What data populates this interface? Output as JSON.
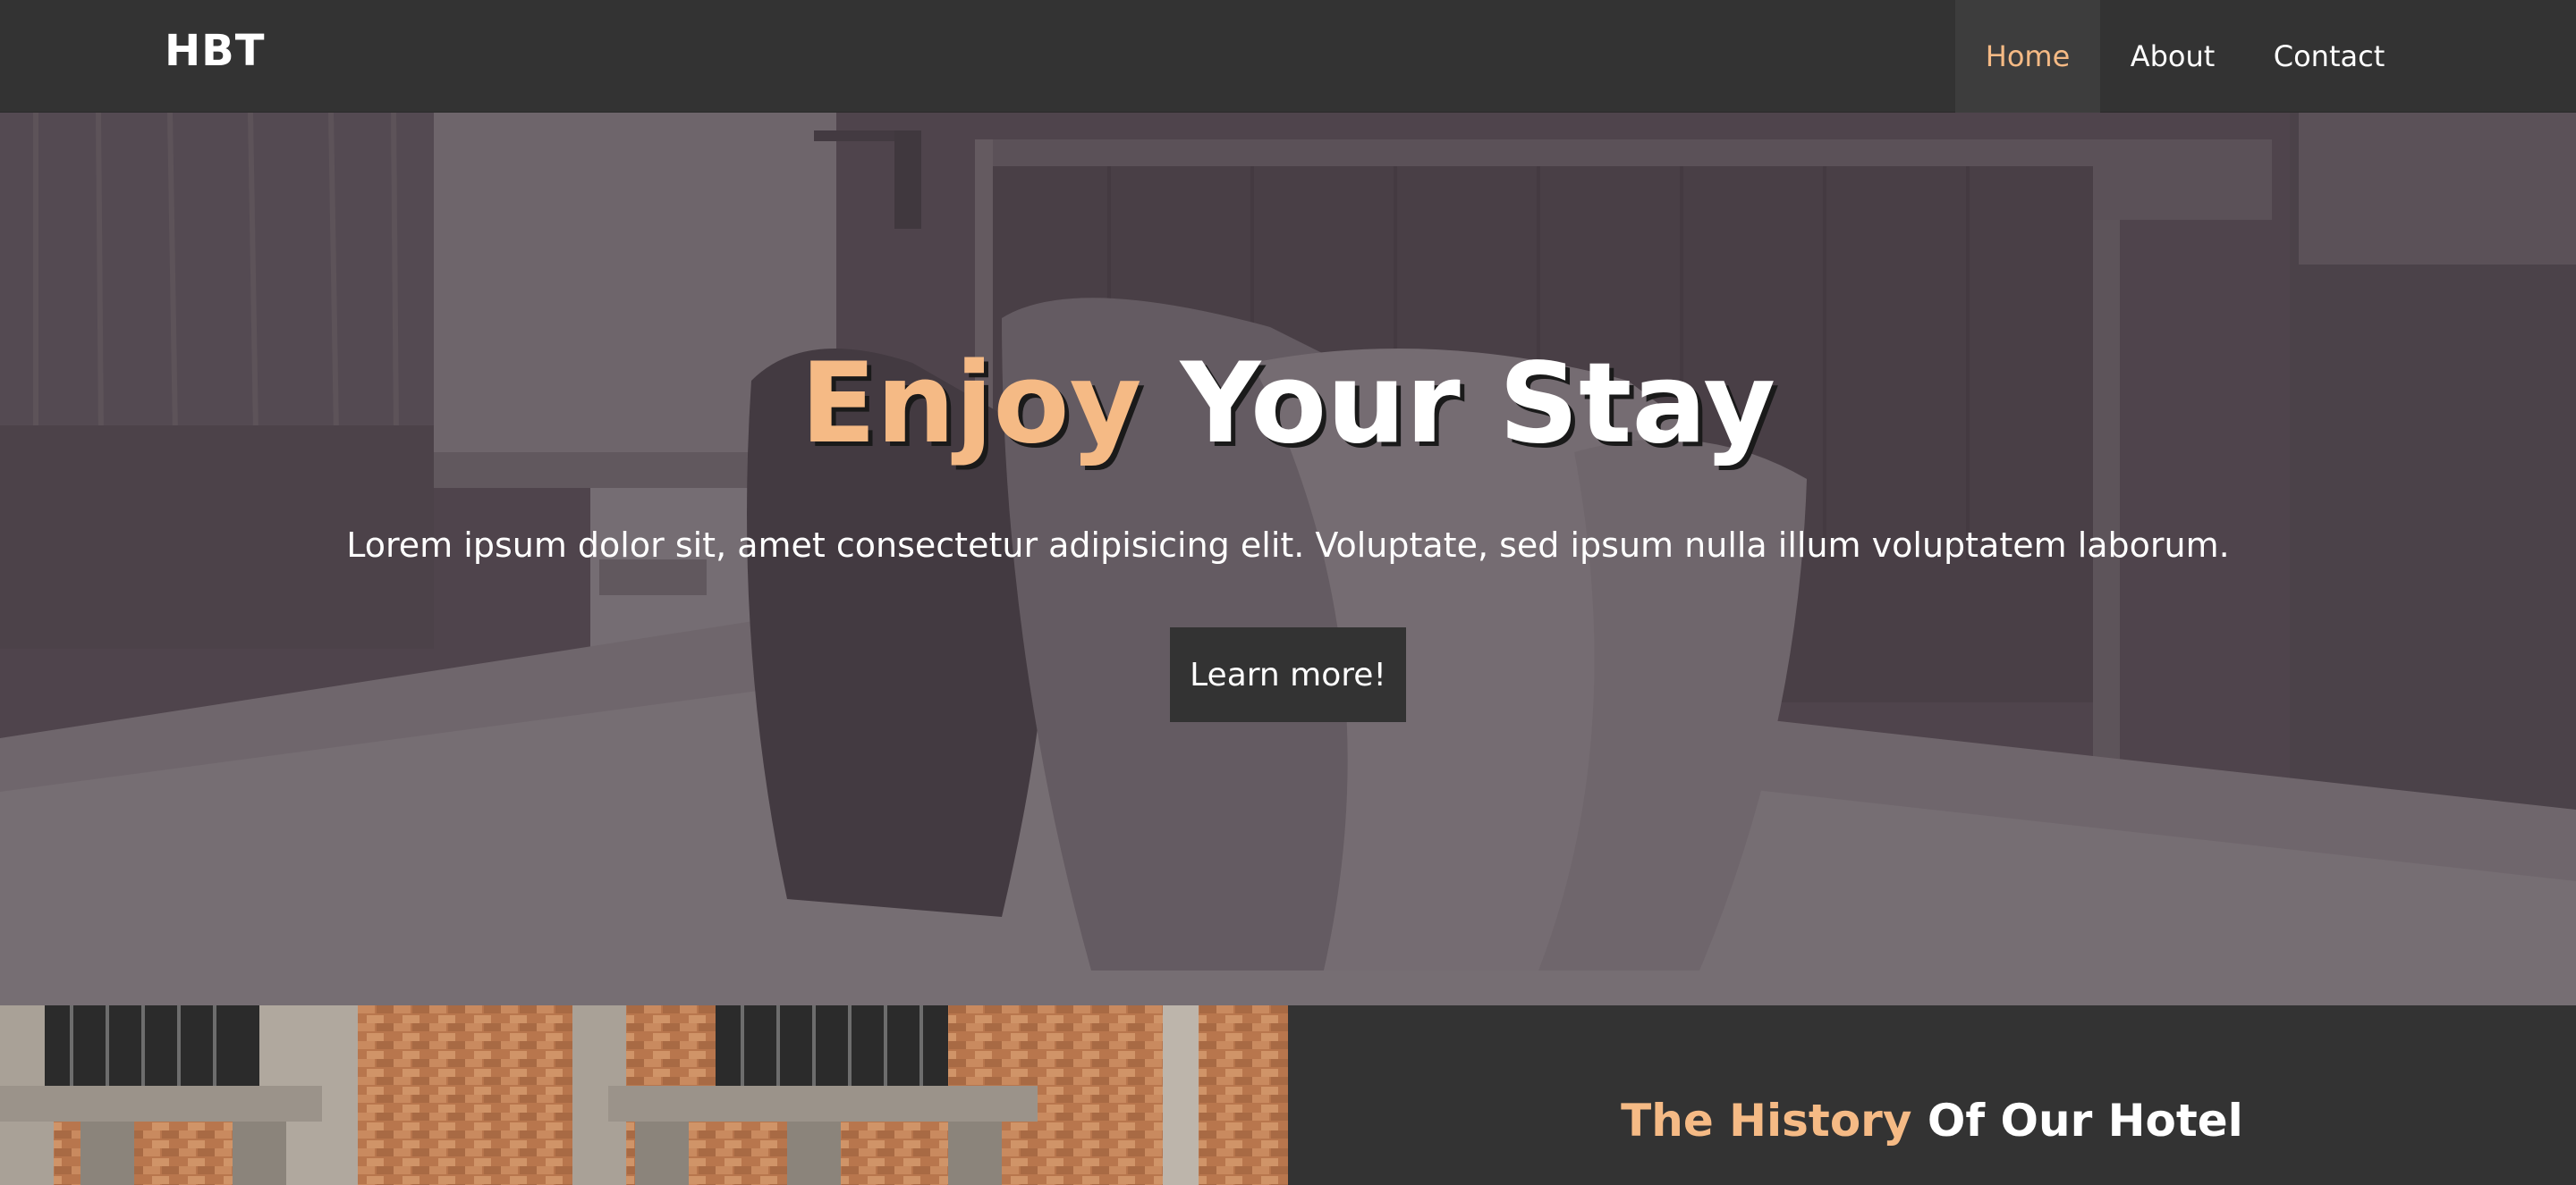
{
  "navbar": {
    "brand": "HBT",
    "links": [
      {
        "label": "Home",
        "active": true
      },
      {
        "label": "About",
        "active": false
      },
      {
        "label": "Contact",
        "active": false
      }
    ]
  },
  "hero": {
    "title_accent": "Enjoy",
    "title_rest": " Your Stay",
    "text": "Lorem ipsum dolor sit, amet consectetur adipisicing elit. Voluptate, sed ipsum nulla illum voluptatem laborum.",
    "button_label": "Learn more!"
  },
  "history": {
    "title_accent": "The History",
    "title_rest": " Of Our Hotel"
  },
  "colors": {
    "accent": "#f5ba85",
    "dark": "#333333",
    "hero_overlay": "#564b52",
    "text": "#ffffff"
  }
}
